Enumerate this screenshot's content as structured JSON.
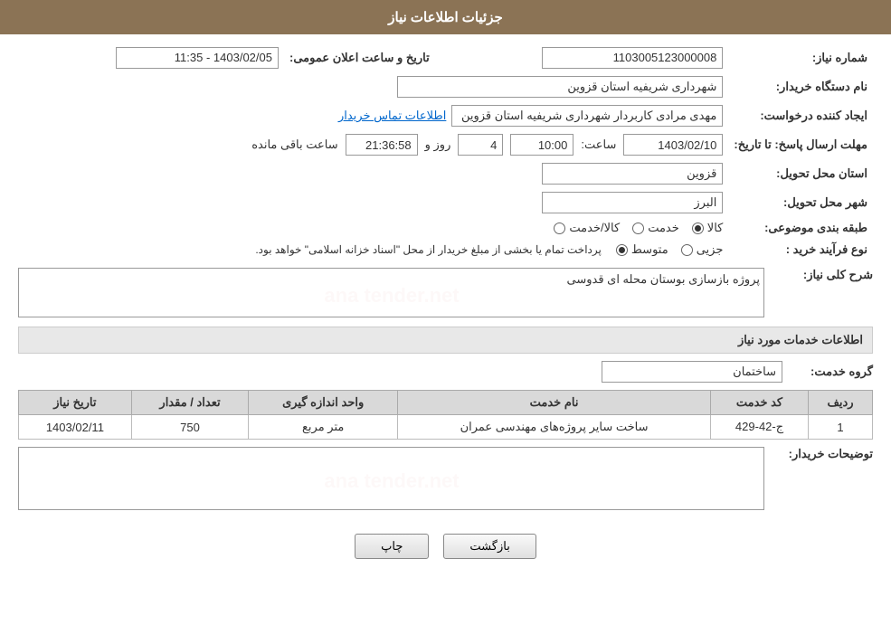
{
  "header": {
    "title": "جزئیات اطلاعات نیاز"
  },
  "form": {
    "need_number_label": "شماره نیاز:",
    "need_number_value": "1103005123000008",
    "buyer_org_label": "نام دستگاه خریدار:",
    "buyer_org_value": "شهرداری شریفیه استان قزوین",
    "announcement_label": "تاریخ و ساعت اعلان عمومی:",
    "announcement_value": "1403/02/05 - 11:35",
    "creator_label": "ایجاد کننده درخواست:",
    "creator_value": "مهدی مرادی کاربردار شهرداری شریفیه استان قزوین",
    "contact_link": "اطلاعات تماس خریدار",
    "deadline_label": "مهلت ارسال پاسخ: تا تاریخ:",
    "deadline_date": "1403/02/10",
    "deadline_time_label": "ساعت:",
    "deadline_time": "10:00",
    "remaining_days_label": "روز و",
    "remaining_days": "4",
    "remaining_time": "21:36:58",
    "remaining_suffix": "ساعت باقی مانده",
    "province_label": "استان محل تحویل:",
    "province_value": "قزوین",
    "city_label": "شهر محل تحویل:",
    "city_value": "البرز",
    "category_label": "طبقه بندی موضوعی:",
    "category_options": [
      {
        "label": "کالا",
        "selected": true
      },
      {
        "label": "خدمت",
        "selected": false
      },
      {
        "label": "کالا/خدمت",
        "selected": false
      }
    ],
    "purchase_type_label": "نوع فرآیند خرید :",
    "purchase_type_options": [
      {
        "label": "جزیی",
        "selected": false
      },
      {
        "label": "متوسط",
        "selected": true
      },
      {
        "label": "",
        "selected": false
      }
    ],
    "purchase_notice": "پرداخت تمام یا بخشی از مبلغ خریدار از محل \"اسناد خزانه اسلامی\" خواهد بود.",
    "description_label": "شرح کلی نیاز:",
    "description_value": "پروژه بازسازی بوستان محله ای قدوسی",
    "services_section_label": "اطلاعات خدمات مورد نیاز",
    "service_group_label": "گروه خدمت:",
    "service_group_value": "ساختمان",
    "table": {
      "headers": [
        "ردیف",
        "کد خدمت",
        "نام خدمت",
        "واحد اندازه گیری",
        "تعداد / مقدار",
        "تاریخ نیاز"
      ],
      "rows": [
        {
          "row_num": "1",
          "service_code": "ج-42-429",
          "service_name": "ساخت سایر پروژه‌های مهندسی عمران",
          "unit": "متر مربع",
          "quantity": "750",
          "date": "1403/02/11"
        }
      ]
    },
    "buyer_notes_label": "توضیحات خریدار:",
    "buyer_notes_value": ""
  },
  "buttons": {
    "print_label": "چاپ",
    "back_label": "بازگشت"
  },
  "watermark_text": "ana tender.net"
}
